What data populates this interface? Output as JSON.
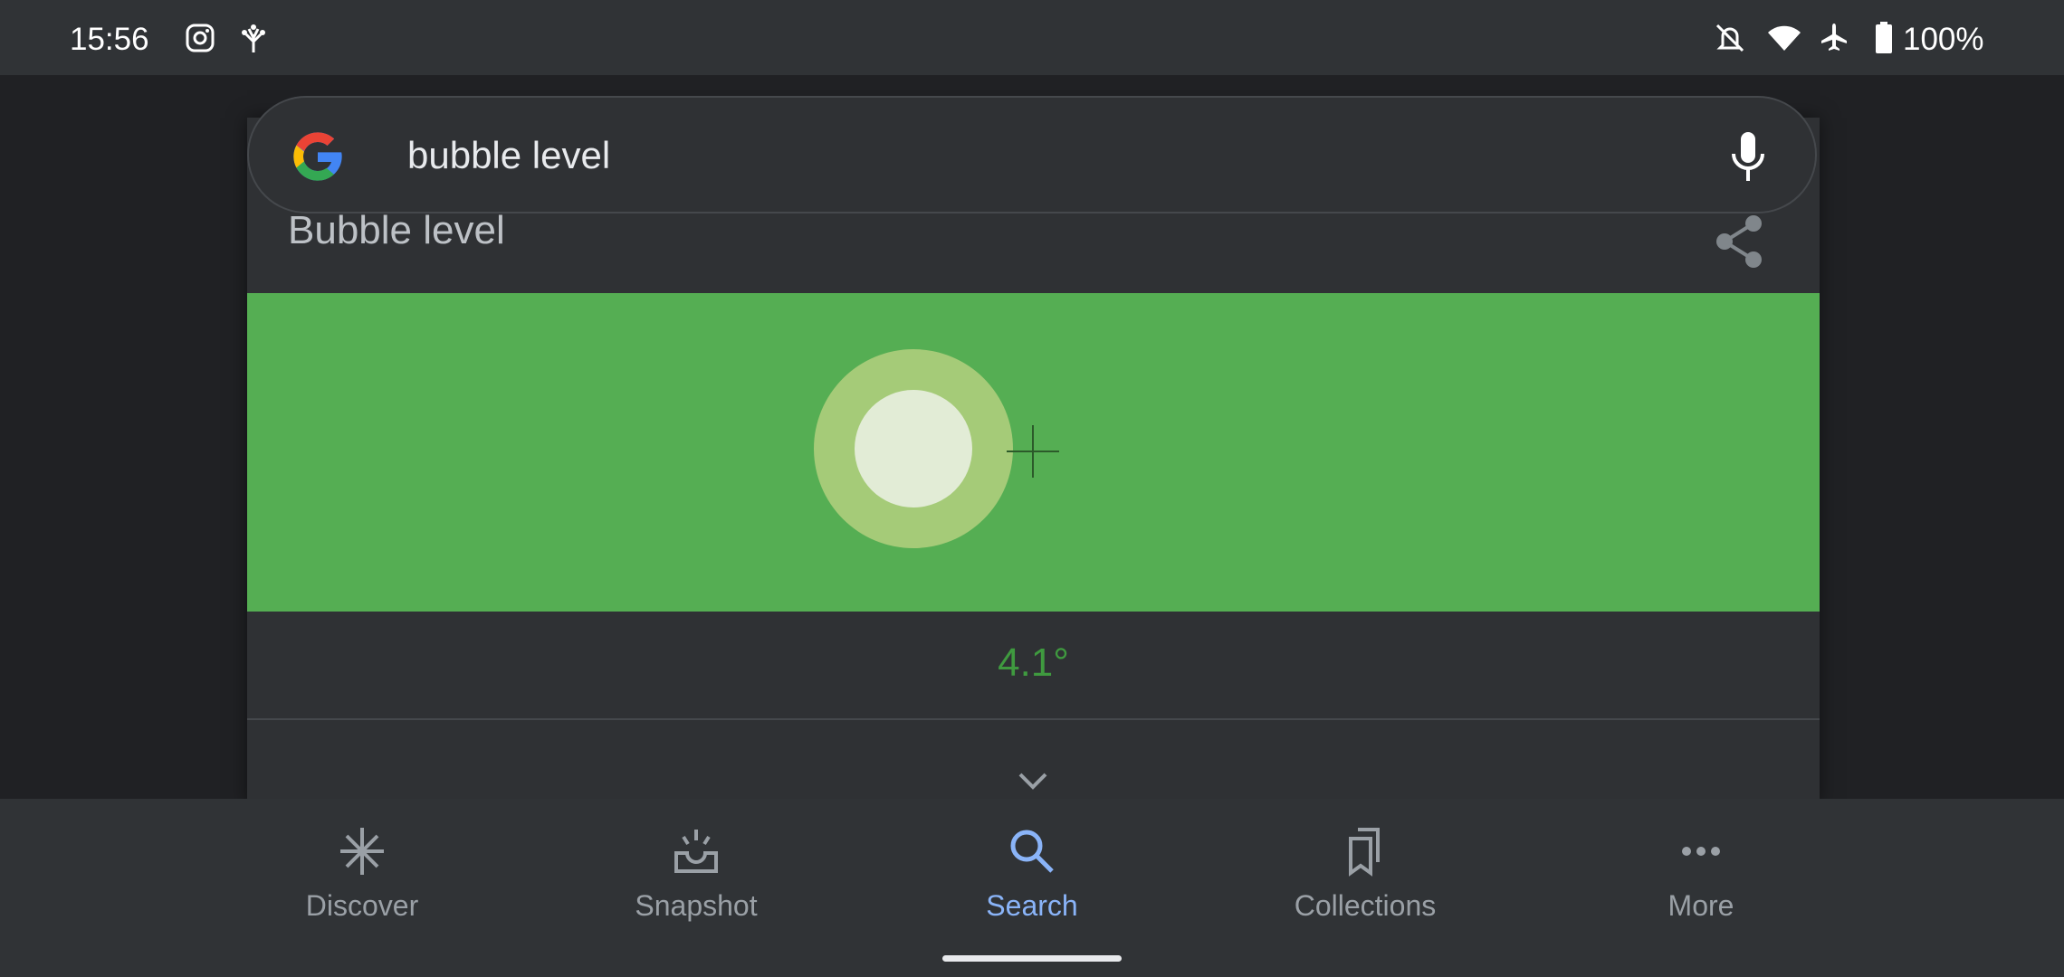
{
  "status_bar": {
    "time": "15:56",
    "battery": "100%",
    "icons": [
      "instagram-icon",
      "tree-icon",
      "notifications-off-icon",
      "wifi-icon",
      "airplane-mode-icon",
      "battery-icon"
    ]
  },
  "search": {
    "query": "bubble level",
    "icons": [
      "google-logo",
      "mic-icon"
    ]
  },
  "card": {
    "title": "Bubble level",
    "angle": "4.1°",
    "level_color": "#55ae53",
    "angle_color": "#3f9a3f"
  },
  "nav": {
    "items": [
      {
        "label": "Discover",
        "icon": "asterisk-icon"
      },
      {
        "label": "Snapshot",
        "icon": "snapshot-icon"
      },
      {
        "label": "Search",
        "icon": "search-icon",
        "active": true
      },
      {
        "label": "Collections",
        "icon": "bookmarks-icon"
      },
      {
        "label": "More",
        "icon": "more-icon"
      }
    ],
    "active_color": "#8ab4f8"
  }
}
